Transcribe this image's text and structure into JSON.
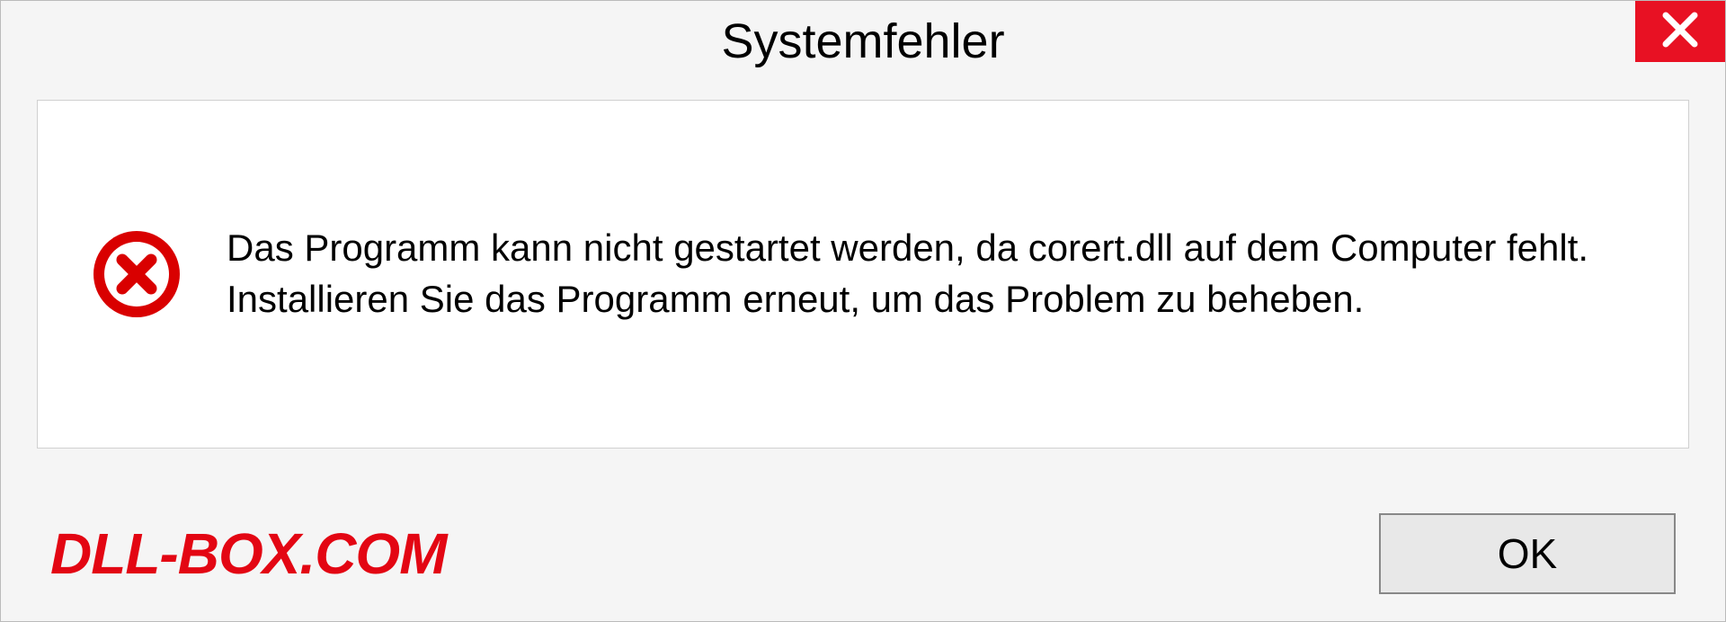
{
  "dialog": {
    "title": "Systemfehler",
    "message": "Das Programm kann nicht gestartet werden, da corert.dll auf dem Computer fehlt. Installieren Sie das Programm erneut, um das Problem zu beheben.",
    "ok_label": "OK"
  },
  "watermark": "DLL-BOX.COM"
}
